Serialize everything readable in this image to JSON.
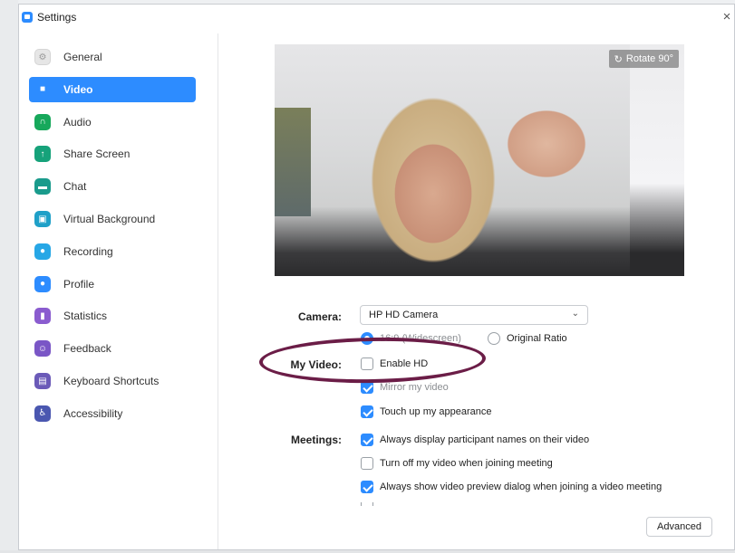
{
  "window": {
    "title": "Settings",
    "close_glyph": "×"
  },
  "colors": {
    "accent": "#2d8cff",
    "annotation": "#6b1d47"
  },
  "sidebar": {
    "items": [
      {
        "label": "General",
        "icon": "gear-icon",
        "color": "#e6e6e6"
      },
      {
        "label": "Video",
        "icon": "video-camera-icon",
        "color": "#2d8cff",
        "active": true
      },
      {
        "label": "Audio",
        "icon": "headphones-icon",
        "color": "#17a85b"
      },
      {
        "label": "Share Screen",
        "icon": "share-screen-icon",
        "color": "#16a27a"
      },
      {
        "label": "Chat",
        "icon": "chat-bubble-icon",
        "color": "#1a9b8c"
      },
      {
        "label": "Virtual Background",
        "icon": "virtual-background-icon",
        "color": "#1fa0c8"
      },
      {
        "label": "Recording",
        "icon": "recording-icon",
        "color": "#27a7e6"
      },
      {
        "label": "Profile",
        "icon": "profile-icon",
        "color": "#2d8cff"
      },
      {
        "label": "Statistics",
        "icon": "statistics-icon",
        "color": "#8a5ccf"
      },
      {
        "label": "Feedback",
        "icon": "feedback-icon",
        "color": "#7a56c6"
      },
      {
        "label": "Keyboard Shortcuts",
        "icon": "keyboard-icon",
        "color": "#6b5ab8"
      },
      {
        "label": "Accessibility",
        "icon": "accessibility-icon",
        "color": "#4a57b0"
      }
    ]
  },
  "preview": {
    "rotate_label": "Rotate 90°"
  },
  "camera": {
    "label": "Camera:",
    "selected": "HP HD Camera",
    "ratio_options": [
      {
        "label": "16:9 (Widescreen)",
        "checked": true
      },
      {
        "label": "Original Ratio",
        "checked": false
      }
    ]
  },
  "my_video": {
    "label": "My Video:",
    "options": [
      {
        "label": "Enable HD",
        "checked": false
      },
      {
        "label": "Mirror my video",
        "checked": true
      },
      {
        "label": "Touch up my appearance",
        "checked": true
      }
    ]
  },
  "meetings": {
    "label": "Meetings:",
    "options": [
      {
        "label": "Always display participant names on their video",
        "checked": true
      },
      {
        "label": "Turn off my video when joining meeting",
        "checked": false
      },
      {
        "label": "Always show video preview dialog when joining a video meeting",
        "checked": true
      }
    ]
  },
  "advanced_label": "Advanced"
}
